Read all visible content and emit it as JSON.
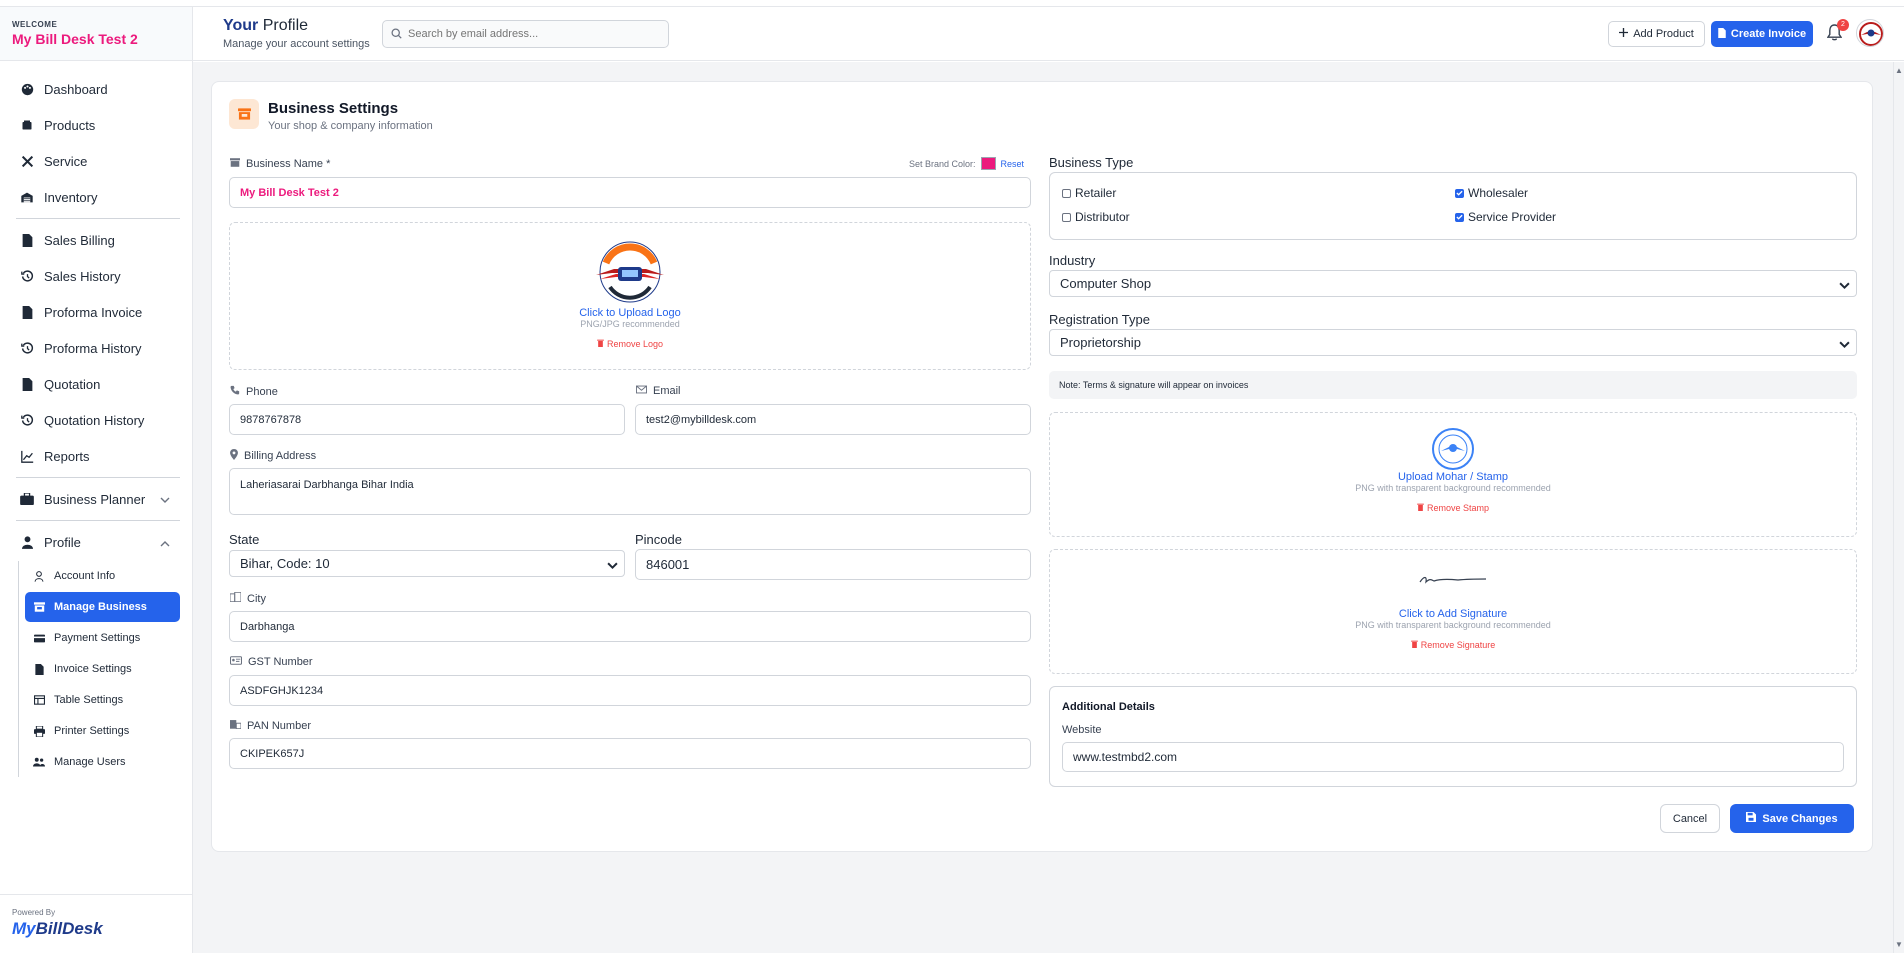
{
  "sidebar": {
    "welcome": "WELCOME",
    "business_name": "My Bill Desk Test 2",
    "items": [
      {
        "label": "Dashboard",
        "icon": "palette-icon"
      },
      {
        "label": "Products",
        "icon": "box-icon"
      },
      {
        "label": "Service",
        "icon": "tools-icon"
      },
      {
        "label": "Inventory",
        "icon": "warehouse-icon"
      },
      {
        "label": "Sales Billing",
        "icon": "file-icon"
      },
      {
        "label": "Sales History",
        "icon": "history-icon"
      },
      {
        "label": "Proforma Invoice",
        "icon": "file-icon"
      },
      {
        "label": "Proforma History",
        "icon": "history-icon"
      },
      {
        "label": "Quotation",
        "icon": "file-icon"
      },
      {
        "label": "Quotation History",
        "icon": "history-icon"
      },
      {
        "label": "Reports",
        "icon": "chart-line-icon"
      },
      {
        "label": "Business Planner",
        "icon": "briefcase-icon"
      },
      {
        "label": "Profile",
        "icon": "user-icon"
      }
    ],
    "profile_sub": [
      {
        "label": "Account Info",
        "icon": "user-outline-icon"
      },
      {
        "label": "Manage Business",
        "icon": "store-icon"
      },
      {
        "label": "Payment Settings",
        "icon": "credit-card-icon"
      },
      {
        "label": "Invoice Settings",
        "icon": "file-icon"
      },
      {
        "label": "Table Settings",
        "icon": "table-icon"
      },
      {
        "label": "Printer Settings",
        "icon": "printer-icon"
      },
      {
        "label": "Manage Users",
        "icon": "users-icon"
      }
    ],
    "active_sub": "Manage Business",
    "powered_by": "Powered By",
    "logo_my": "My",
    "logo_rest": "BillDesk"
  },
  "header": {
    "title_your": "Your",
    "title_rest": " Profile",
    "subtitle": "Manage your account settings",
    "search_placeholder": "Search by email address...",
    "add_product": "Add Product",
    "create_invoice": "Create Invoice",
    "notification_count": "2"
  },
  "card": {
    "title": "Business Settings",
    "subtitle": "Your shop & company information"
  },
  "form": {
    "business_name_label": "Business Name *",
    "business_name_value": "My Bill Desk Test 2",
    "brand_color_label": "Set Brand Color:",
    "brand_color": "#ec1a7d",
    "reset_label": "Reset",
    "logo_upload": "Click to Upload Logo",
    "logo_hint": "PNG/JPG recommended",
    "logo_remove": "Remove Logo",
    "phone_label": "Phone",
    "phone_value": "9878767878",
    "email_label": "Email",
    "email_value": "test2@mybilldesk.com",
    "address_label": "Billing Address",
    "address_value": "Laheriasarai Darbhanga Bihar India",
    "state_label": "State",
    "state_value": "Bihar, Code: 10",
    "pincode_label": "Pincode",
    "pincode_value": "846001",
    "city_label": "City",
    "city_value": "Darbhanga",
    "gst_label": "GST Number",
    "gst_value": "ASDFGHJK1234",
    "pan_label": "PAN Number",
    "pan_value": "CKIPEK657J"
  },
  "right": {
    "business_type_label": "Business Type",
    "types": [
      {
        "label": "Retailer",
        "checked": false
      },
      {
        "label": "Wholesaler",
        "checked": true
      },
      {
        "label": "Distributor",
        "checked": false
      },
      {
        "label": "Service Provider",
        "checked": true
      }
    ],
    "industry_label": "Industry",
    "industry_value": "Computer Shop",
    "registration_label": "Registration Type",
    "registration_value": "Proprietorship",
    "note": "Note: Terms & signature will appear on invoices",
    "stamp_upload": "Upload Mohar / Stamp",
    "stamp_hint": "PNG with transparent background recommended",
    "stamp_remove": "Remove Stamp",
    "sign_upload": "Click to Add Signature",
    "sign_hint": "PNG with transparent background recommended",
    "sign_remove": "Remove Signature",
    "additional_title": "Additional Details",
    "website_label": "Website",
    "website_value": "www.testmbd2.com"
  },
  "actions": {
    "cancel": "Cancel",
    "save": "Save Changes"
  },
  "colors": {
    "primary": "#2563eb",
    "brand": "#ec1a7d",
    "danger": "#ef4444"
  }
}
